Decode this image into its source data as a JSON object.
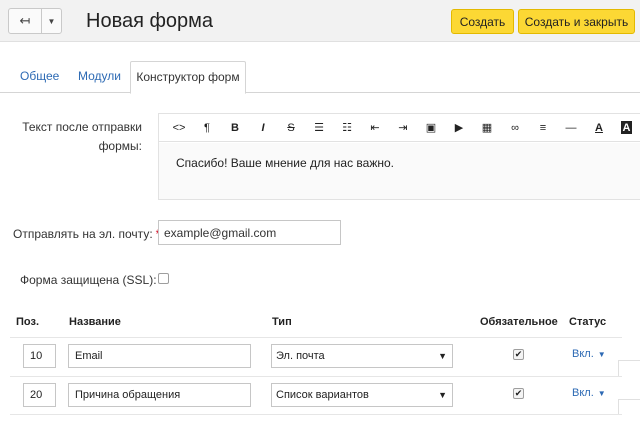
{
  "header": {
    "back_glyph": "↤",
    "drop_glyph": "▼",
    "title": "Новая форма",
    "create_label": "Создать",
    "create_close_label": "Создать и закрыть"
  },
  "tabs": [
    {
      "label": "Общее",
      "active": false
    },
    {
      "label": "Модули",
      "active": false
    },
    {
      "label": "Конструктор форм",
      "active": true
    }
  ],
  "editor": {
    "label": "Текст после отправки формы:",
    "content": "Спасибо! Ваше мнение для нас важно.",
    "toolbar": [
      {
        "name": "source-icon",
        "glyph": "<>"
      },
      {
        "name": "paragraph-icon",
        "glyph": "¶"
      },
      {
        "name": "bold-icon",
        "glyph": "B"
      },
      {
        "name": "italic-icon",
        "glyph": "I"
      },
      {
        "name": "strikethrough-icon",
        "glyph": "S"
      },
      {
        "name": "bullet-list-icon",
        "glyph": "☰"
      },
      {
        "name": "numbered-list-icon",
        "glyph": "☷"
      },
      {
        "name": "outdent-icon",
        "glyph": "⇤"
      },
      {
        "name": "indent-icon",
        "glyph": "⇥"
      },
      {
        "name": "image-icon",
        "glyph": "▣"
      },
      {
        "name": "video-icon",
        "glyph": "▶"
      },
      {
        "name": "table-icon",
        "glyph": "▦"
      },
      {
        "name": "link-icon",
        "glyph": "∞"
      },
      {
        "name": "align-icon",
        "glyph": "≡"
      },
      {
        "name": "horizontal-rule-icon",
        "glyph": "—"
      },
      {
        "name": "font-color-icon",
        "glyph": "A"
      },
      {
        "name": "background-color-icon",
        "glyph": "A"
      }
    ]
  },
  "email": {
    "label": "Отправлять на эл. почту:",
    "required_mark": "*",
    "value": "example@gmail.com"
  },
  "ssl": {
    "label": "Форма защищена (SSL):",
    "checked": false
  },
  "table": {
    "headers": {
      "pos": "Поз.",
      "name": "Название",
      "type": "Тип",
      "required": "Обязательное",
      "status": "Статус"
    },
    "rows": [
      {
        "pos": "10",
        "name": "Email",
        "type": "Эл. почта",
        "required": true,
        "status": "Вкл."
      },
      {
        "pos": "20",
        "name": "Причина обращения",
        "type": "Список вариантов",
        "required": true,
        "status": "Вкл."
      }
    ],
    "select_arrow": "▼",
    "status_caret": "▼",
    "check_glyph": "✔"
  },
  "colors": {
    "accent_yellow": "#fcd834",
    "link_blue": "#2d6ab4",
    "required_red": "#d0021b"
  }
}
